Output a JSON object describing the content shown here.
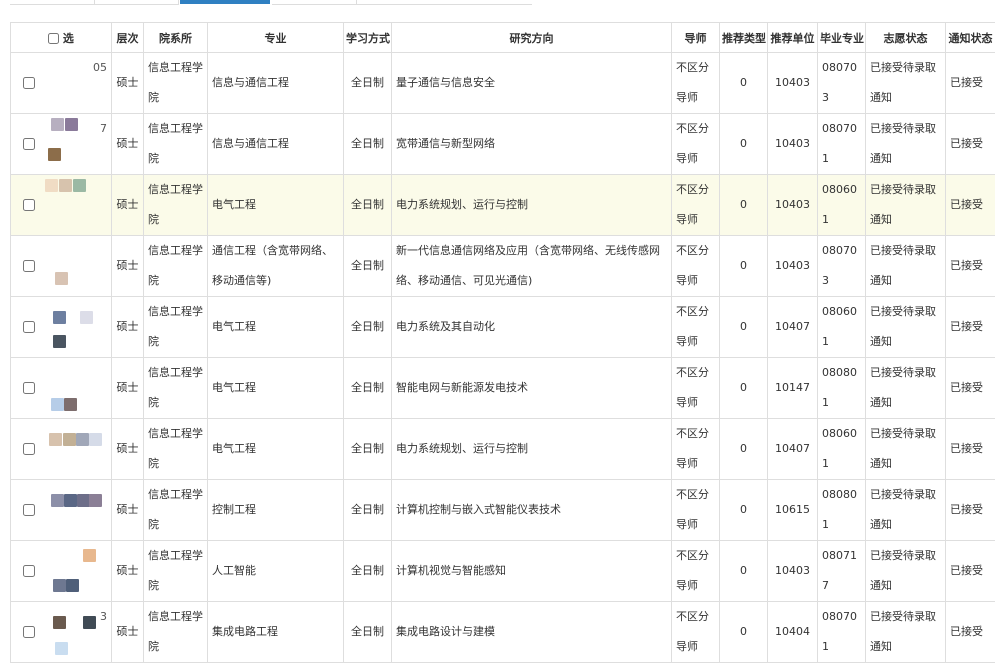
{
  "table": {
    "headers": {
      "select": "选",
      "level": "层次",
      "dept": "院系所",
      "major": "专业",
      "mode": "学习方式",
      "direction": "研究方向",
      "advisor": "导师",
      "rec_type": "推荐类型",
      "rec_unit": "推荐单位",
      "grad_major": "毕业专业",
      "status": "志愿状态",
      "notice": "通知状态"
    },
    "rows": [
      {
        "id_fragment": "05",
        "level": "硕士",
        "dept": "信息工程学院",
        "major": "信息与通信工程",
        "mode": "全日制",
        "direction": "量子通信与信息安全",
        "advisor": "不区分导师",
        "rec_type": "0",
        "rec_unit": "10403",
        "grad_major": "080703",
        "status": "已接受待录取通知",
        "notice": "已接受"
      },
      {
        "id_fragment": "7",
        "level": "硕士",
        "dept": "信息工程学院",
        "major": "信息与通信工程",
        "mode": "全日制",
        "direction": "宽带通信与新型网络",
        "advisor": "不区分导师",
        "rec_type": "0",
        "rec_unit": "10403",
        "grad_major": "080701",
        "status": "已接受待录取通知",
        "notice": "已接受"
      },
      {
        "id_fragment": "",
        "level": "硕士",
        "dept": "信息工程学院",
        "major": "电气工程",
        "mode": "全日制",
        "direction": "电力系统规划、运行与控制",
        "advisor": "不区分导师",
        "rec_type": "0",
        "rec_unit": "10403",
        "grad_major": "080601",
        "status": "已接受待录取通知",
        "notice": "已接受"
      },
      {
        "id_fragment": "",
        "level": "硕士",
        "dept": "信息工程学院",
        "major": "通信工程（含宽带网络、移动通信等)",
        "mode": "全日制",
        "direction": "新一代信息通信网络及应用（含宽带网络、无线传感网络、移动通信、可见光通信)",
        "advisor": "不区分导师",
        "rec_type": "0",
        "rec_unit": "10403",
        "grad_major": "080703",
        "status": "已接受待录取通知",
        "notice": "已接受"
      },
      {
        "id_fragment": "",
        "level": "硕士",
        "dept": "信息工程学院",
        "major": "电气工程",
        "mode": "全日制",
        "direction": "电力系统及其自动化",
        "advisor": "不区分导师",
        "rec_type": "0",
        "rec_unit": "10407",
        "grad_major": "080601",
        "status": "已接受待录取通知",
        "notice": "已接受"
      },
      {
        "id_fragment": "",
        "level": "硕士",
        "dept": "信息工程学院",
        "major": "电气工程",
        "mode": "全日制",
        "direction": "智能电网与新能源发电技术",
        "advisor": "不区分导师",
        "rec_type": "0",
        "rec_unit": "10147",
        "grad_major": "080801",
        "status": "已接受待录取通知",
        "notice": "已接受"
      },
      {
        "id_fragment": "",
        "level": "硕士",
        "dept": "信息工程学院",
        "major": "电气工程",
        "mode": "全日制",
        "direction": "电力系统规划、运行与控制",
        "advisor": "不区分导师",
        "rec_type": "0",
        "rec_unit": "10407",
        "grad_major": "080601",
        "status": "已接受待录取通知",
        "notice": "已接受"
      },
      {
        "id_fragment": "",
        "level": "硕士",
        "dept": "信息工程学院",
        "major": "控制工程",
        "mode": "全日制",
        "direction": "计算机控制与嵌入式智能仪表技术",
        "advisor": "不区分导师",
        "rec_type": "0",
        "rec_unit": "10615",
        "grad_major": "080801",
        "status": "已接受待录取通知",
        "notice": "已接受"
      },
      {
        "id_fragment": "",
        "level": "硕士",
        "dept": "信息工程学院",
        "major": "人工智能",
        "mode": "全日制",
        "direction": "计算机视觉与智能感知",
        "advisor": "不区分导师",
        "rec_type": "0",
        "rec_unit": "10403",
        "grad_major": "080717",
        "status": "已接受待录取通知",
        "notice": "已接受"
      },
      {
        "id_fragment": "3",
        "level": "硕士",
        "dept": "信息工程学院",
        "major": "集成电路工程",
        "mode": "全日制",
        "direction": "集成电路设计与建模",
        "advisor": "不区分导师",
        "rec_type": "0",
        "rec_unit": "10404",
        "grad_major": "080701",
        "status": "已接受待录取通知",
        "notice": "已接受"
      }
    ],
    "highlight_row": 2,
    "colors": {
      "highlight": "#fbfbe9",
      "active_tab": "#2f80c2",
      "border": "#dedede"
    }
  }
}
